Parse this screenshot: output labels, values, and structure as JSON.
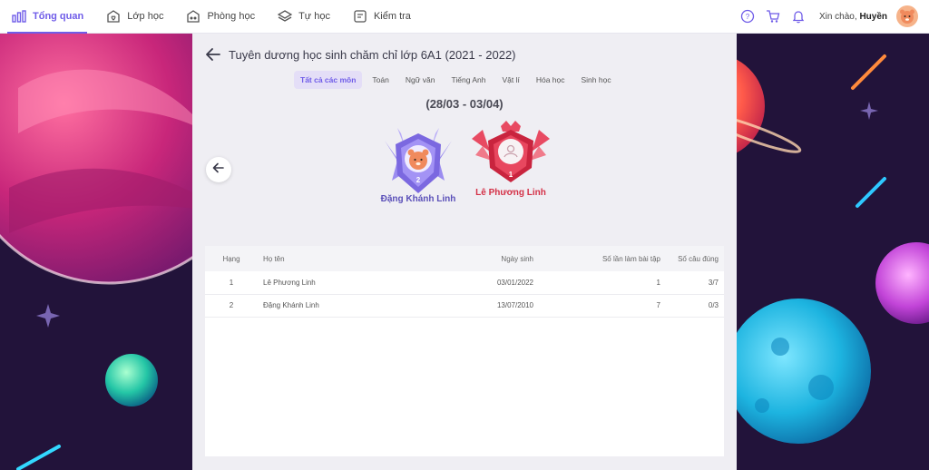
{
  "nav": {
    "items": [
      {
        "label": "Tổng quan",
        "icon": "dashboard-icon"
      },
      {
        "label": "Lớp học",
        "icon": "class-icon"
      },
      {
        "label": "Phòng học",
        "icon": "room-icon"
      },
      {
        "label": "Tự học",
        "icon": "layers-icon"
      },
      {
        "label": "Kiểm tra",
        "icon": "test-icon"
      }
    ],
    "greeting_prefix": "Xin chào,",
    "user_name": "Huyền"
  },
  "page": {
    "title": "Tuyên dương học sinh chăm chỉ lớp 6A1 (2021 - 2022)",
    "subject_tabs": [
      "Tất cả các môn",
      "Toán",
      "Ngữ văn",
      "Tiếng Anh",
      "Vật lí",
      "Hóa học",
      "Sinh học"
    ],
    "active_tab": "Tất cả các môn",
    "week_range": "(28/03 - 03/04)"
  },
  "podium": {
    "second": {
      "rank": "2",
      "name": "Đặng Khánh Linh"
    },
    "first": {
      "rank": "1",
      "name": "Lê Phương Linh"
    }
  },
  "table": {
    "headers": [
      "Hạng",
      "Họ tên",
      "Ngày sinh",
      "Số lần làm bài tập",
      "Số câu đúng"
    ],
    "rows": [
      [
        "1",
        "Lê Phương Linh",
        "03/01/2022",
        "1",
        "3/7"
      ],
      [
        "2",
        "Đặng Khánh Linh",
        "13/07/2010",
        "7",
        "0/3"
      ]
    ]
  },
  "colors": {
    "accent": "#6f5ce8",
    "rank1": "#d43046",
    "rank2": "#5a4fb8"
  }
}
